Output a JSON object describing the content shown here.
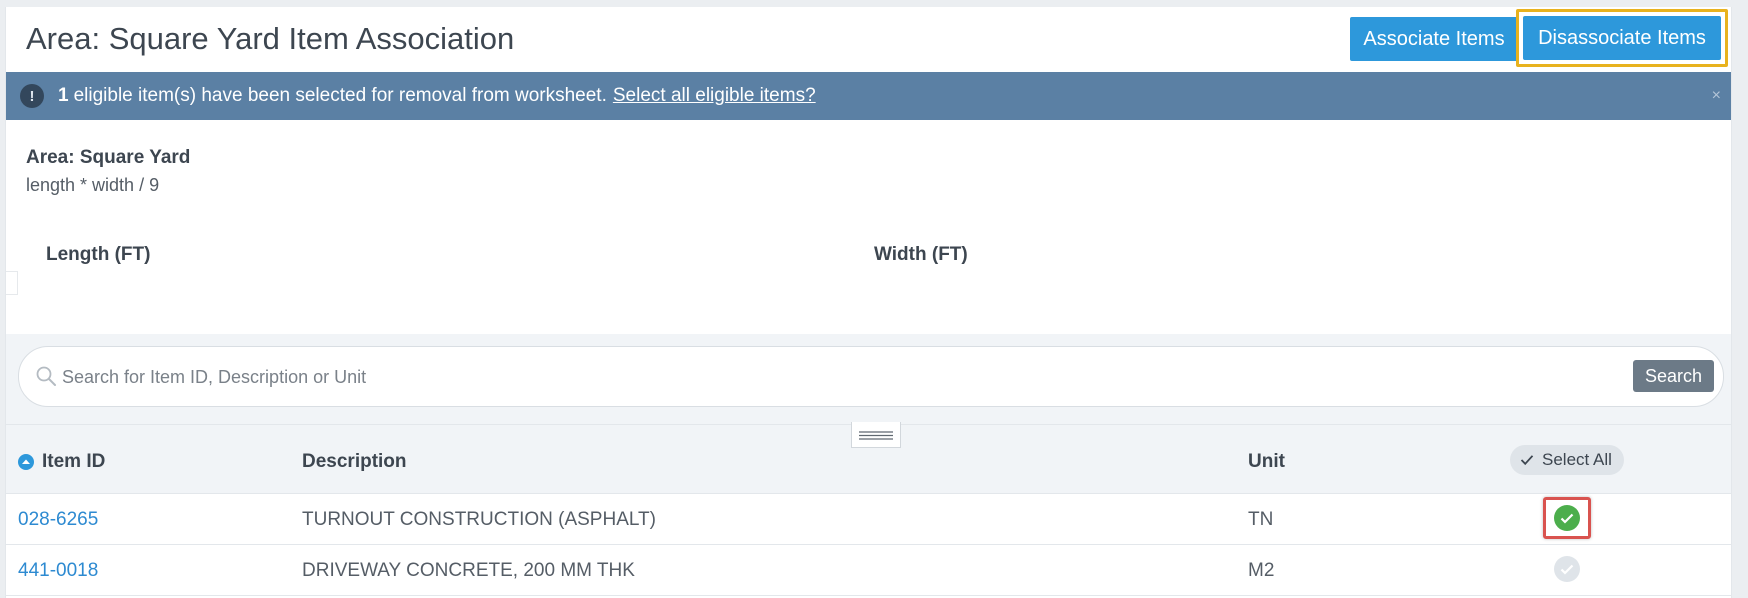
{
  "header": {
    "title": "Area: Square Yard Item Association",
    "associate_label": "Associate Items",
    "disassociate_label": "Disassociate Items"
  },
  "alert": {
    "icon": "!",
    "count": "1",
    "message": "eligible item(s) have been selected for removal from worksheet.",
    "link": "Select all eligible items?",
    "close": "×"
  },
  "formula": {
    "name": "Area: Square Yard",
    "expression": "length * width / 9",
    "variables": [
      "Length (FT)",
      "Width (FT)"
    ]
  },
  "search": {
    "placeholder": "Search for Item ID, Description or Unit",
    "button": "Search"
  },
  "table": {
    "headers": {
      "item_id": "Item ID",
      "description": "Description",
      "unit": "Unit",
      "select_all": "Select All"
    },
    "rows": [
      {
        "item_id": "028-6265",
        "description": "TURNOUT CONSTRUCTION (ASPHALT)",
        "unit": "TN",
        "selected": true
      },
      {
        "item_id": "441-0018",
        "description": "DRIVEWAY CONCRETE, 200 MM THK",
        "unit": "M2",
        "selected": false
      }
    ]
  },
  "colors": {
    "primary": "#2d98db",
    "alert_bg": "#5b80a4",
    "highlight_gold": "#e8b21e",
    "highlight_red": "#d9534f",
    "check_green": "#4cae4c",
    "link": "#2d8ad1"
  }
}
